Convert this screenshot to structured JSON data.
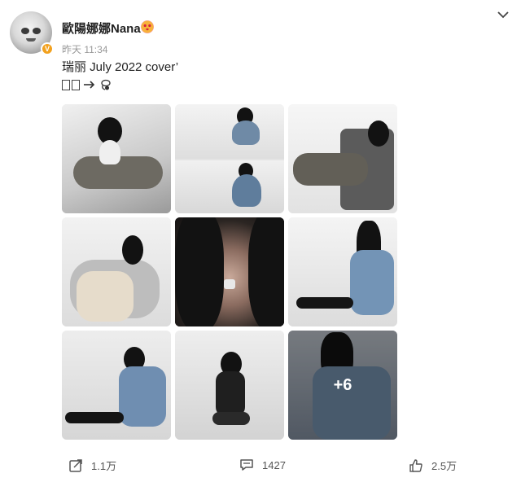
{
  "post": {
    "username": "歐陽娜娜Nana",
    "timestamp": "昨天 11:34",
    "text": "瑞丽 July 2022 cover’",
    "more_count_label": "+6"
  },
  "actions": {
    "share_count": "1.1万",
    "comment_count": "1427",
    "like_count": "2.5万"
  },
  "icons": {
    "avatar_badge": "verified-v-icon",
    "user_badge": "kiss-face-emoji-icon",
    "menu": "chevron-down-icon",
    "share": "share-icon",
    "comment": "comment-icon",
    "like": "thumb-up-icon"
  },
  "colors": {
    "verified_badge": "#f2a11e",
    "text_primary": "#222222",
    "text_secondary": "#999999"
  }
}
